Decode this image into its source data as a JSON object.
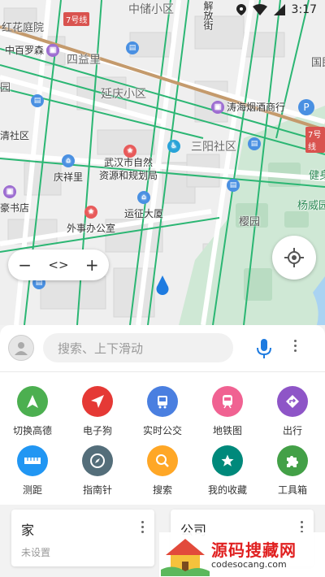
{
  "status_bar": {
    "time": "3:17"
  },
  "map": {
    "labels": {
      "honghua": "红花庭院",
      "zhongchu": "中储小区",
      "line7_top": "7号线",
      "zhongbai": "中百罗森",
      "siyili": "四益里",
      "jiefang_jie": "解放街",
      "yuan": "园",
      "yanqing": "延庆小区",
      "taohai": "涛海烟酒商行",
      "guomin": "国民",
      "line7_right": "7号线",
      "qingshe": "清社区",
      "wuhan_ziran": "武汉市自然\n资源和规划局",
      "sanyang": "三阳社区",
      "qingxiang": "庆祥里",
      "jian": "健身",
      "yunzheng": "运征大厦",
      "yangwei": "杨威园",
      "haoshu": "豪书店",
      "waishi": "外事办公室",
      "yingyuan": "樱园"
    },
    "zoom": {
      "minus": "−",
      "code": "<>",
      "plus": "+"
    },
    "icons": {
      "locate": "locate-icon",
      "me": "current-location-marker"
    }
  },
  "search": {
    "placeholder": "搜索、上下滑动",
    "mic_icon": "microphone-icon",
    "more_icon": "more-vertical-icon"
  },
  "shortcuts": [
    {
      "label": "切换高德",
      "icon": "navigation-arrow-icon",
      "color": "#4caf50"
    },
    {
      "label": "电子狗",
      "icon": "send-arrow-icon",
      "color": "#e53935"
    },
    {
      "label": "实时公交",
      "icon": "bus-icon",
      "color": "#4a7fe0"
    },
    {
      "label": "地铁图",
      "icon": "metro-icon",
      "color": "#f06292"
    },
    {
      "label": "出行",
      "icon": "route-icon",
      "color": "#8e55c7"
    },
    {
      "label": "测距",
      "icon": "ruler-icon",
      "color": "#2196f3"
    },
    {
      "label": "指南针",
      "icon": "compass-icon",
      "color": "#546e7a"
    },
    {
      "label": "搜索",
      "icon": "search-icon",
      "color": "#ffa726"
    },
    {
      "label": "我的收藏",
      "icon": "star-icon",
      "color": "#00897b"
    },
    {
      "label": "工具箱",
      "icon": "puzzle-icon",
      "color": "#43a047"
    }
  ],
  "favorites": [
    {
      "title": "家",
      "subtitle": "未设置"
    },
    {
      "title": "公司",
      "subtitle": ""
    }
  ],
  "watermark": {
    "text": "源码搜藏网",
    "url": "codesocang.com"
  }
}
